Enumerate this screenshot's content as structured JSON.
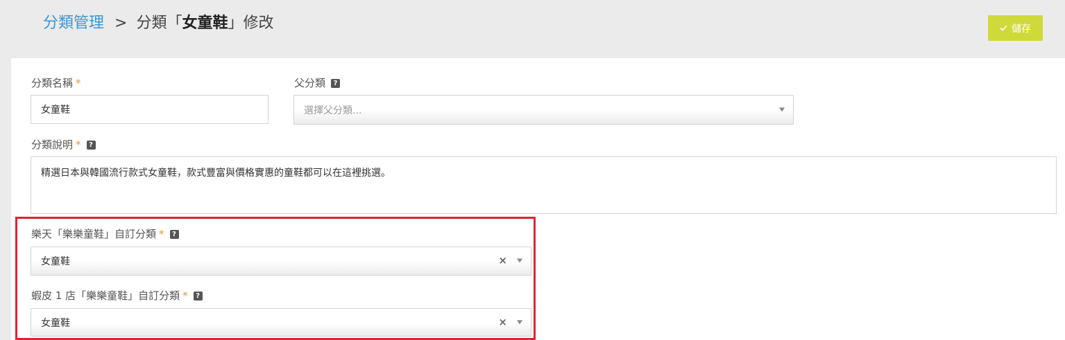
{
  "breadcrumb": {
    "parent": "分類管理",
    "separator": ">",
    "current_prefix": "分類「",
    "current_name": "女童鞋",
    "current_suffix": "」修改"
  },
  "toolbar": {
    "save_label": "儲存",
    "save_icon": "check-icon"
  },
  "form": {
    "name": {
      "label": "分類名稱",
      "required_mark": "*",
      "value": "女童鞋"
    },
    "parent": {
      "label": "父分類",
      "help": "?",
      "placeholder": "選擇父分類..."
    },
    "description": {
      "label": "分類說明",
      "required_mark": "*",
      "help": "?",
      "value": "精選日本與韓國流行款式女童鞋，款式豐富與價格實惠的童鞋都可以在這裡挑選。"
    },
    "rakuten_category": {
      "label": "樂天「樂樂童鞋」自訂分類",
      "required_mark": "*",
      "help": "?",
      "value": "女童鞋",
      "clear": "×"
    },
    "shopee_category": {
      "label": "蝦皮 1 店「樂樂童鞋」自訂分類",
      "required_mark": "*",
      "help": "?",
      "value": "女童鞋",
      "clear": "×"
    }
  },
  "colors": {
    "link": "#3a97d4",
    "save_button": "#cfd93a",
    "required": "#e8962e",
    "highlight": "#e0242f",
    "header_bg": "#ebebeb"
  }
}
